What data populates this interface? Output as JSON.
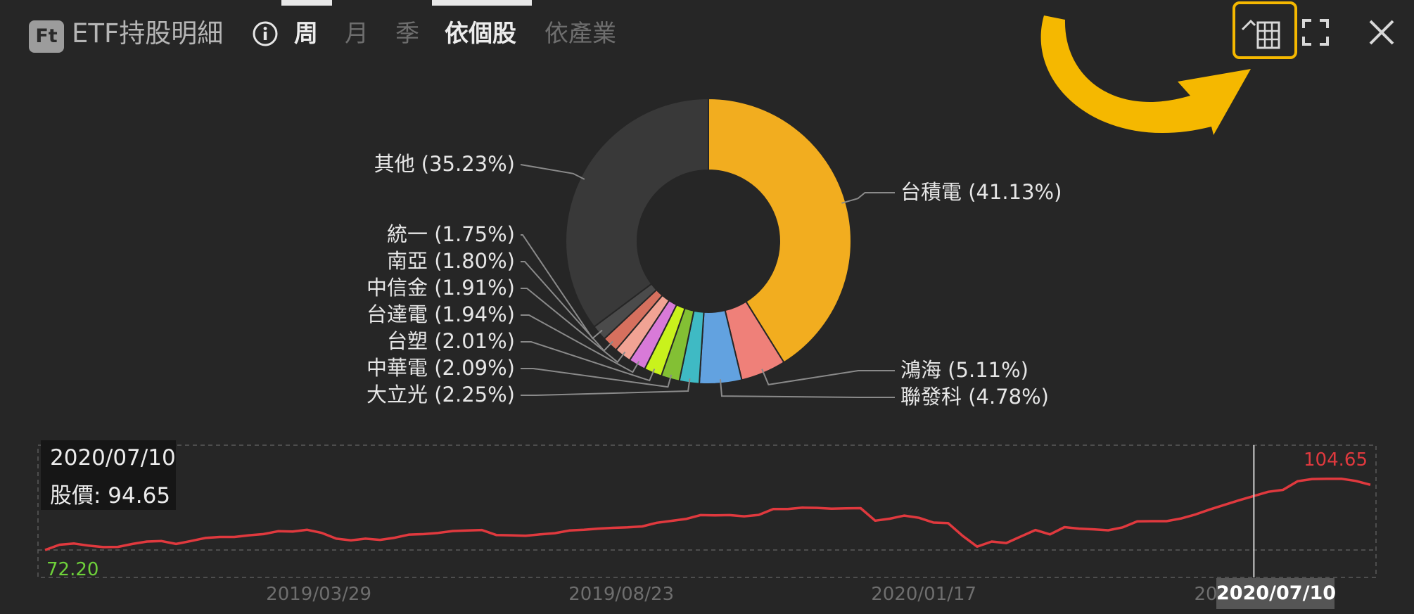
{
  "header": {
    "logo_text": "Ft",
    "title": "ETF持股明細",
    "info_icon": "info-icon",
    "period_tabs": [
      {
        "label": "周",
        "active": true
      },
      {
        "label": "月",
        "active": false
      },
      {
        "label": "季",
        "active": false
      }
    ],
    "view_tabs": [
      {
        "label": "依個股",
        "active": true
      },
      {
        "label": "依產業",
        "active": false
      }
    ],
    "tools": {
      "calculator_icon": "calculator-icon",
      "fullscreen_icon": "fullscreen-icon",
      "close_icon": "close-icon"
    }
  },
  "colors": {
    "background": "#262626",
    "highlight": "#f5b800",
    "price_line": "#e0393e",
    "min_label": "#6ed13a",
    "max_label": "#e0393e"
  },
  "chart_data": [
    {
      "type": "pie",
      "donut": true,
      "slices": [
        {
          "name": "台積電",
          "value": 41.13,
          "label": "台積電 (41.13%)",
          "color": "#f2ad1f"
        },
        {
          "name": "鴻海",
          "value": 5.11,
          "label": "鴻海 (5.11%)",
          "color": "#ef8079"
        },
        {
          "name": "聯發科",
          "value": 4.78,
          "label": "聯發科 (4.78%)",
          "color": "#62a2e0"
        },
        {
          "name": "大立光",
          "value": 2.25,
          "label": "大立光 (2.25%)",
          "color": "#3fbac4"
        },
        {
          "name": "中華電",
          "value": 2.09,
          "label": "中華電 (2.09%)",
          "color": "#83c034"
        },
        {
          "name": "台塑",
          "value": 2.01,
          "label": "台塑 (2.01%)",
          "color": "#c9f21c"
        },
        {
          "name": "台達電",
          "value": 1.94,
          "label": "台達電 (1.94%)",
          "color": "#d87ad8"
        },
        {
          "name": "中信金",
          "value": 1.91,
          "label": "中信金 (1.91%)",
          "color": "#f1a394"
        },
        {
          "name": "南亞",
          "value": 1.8,
          "label": "南亞 (1.80%)",
          "color": "#d6705e"
        },
        {
          "name": "統一",
          "value": 1.75,
          "label": "統一 (1.75%)",
          "color": "#4b4b4b"
        },
        {
          "name": "其他",
          "value": 35.23,
          "label": "其他 (35.23%)",
          "color": "#393939"
        }
      ]
    },
    {
      "type": "line",
      "x_ticks": [
        "2019/03/29",
        "2019/08/23",
        "2020/01/17",
        "2020/06/12"
      ],
      "x_tick_labels": [
        "2019/03/29",
        "2019/08/23",
        "2020/01/17",
        "2020/0"
      ],
      "x_start": "2018/11/16",
      "x_end": "2020/08/21",
      "ylim": [
        72.2,
        104.65
      ],
      "min_label": "72.20",
      "max_label": "104.65",
      "series": [
        {
          "values": [
            72.2,
            74.4,
            74.9,
            74.0,
            73.4,
            73.5,
            74.7,
            75.7,
            75.9,
            74.7,
            75.9,
            77.2,
            77.6,
            77.6,
            78.3,
            78.8,
            80.0,
            79.9,
            80.6,
            79.3,
            76.9,
            76.2,
            76.9,
            76.4,
            77.3,
            78.6,
            78.8,
            79.3,
            80.1,
            80.3,
            80.5,
            78.4,
            78.3,
            78.1,
            78.7,
            79.2,
            80.3,
            80.6,
            81.1,
            81.4,
            81.6,
            82.0,
            83.5,
            84.3,
            85.1,
            86.7,
            86.6,
            86.7,
            86.2,
            86.8,
            89.2,
            89.2,
            89.8,
            89.7,
            89.4,
            89.5,
            89.6,
            84.4,
            85.2,
            86.5,
            85.6,
            83.6,
            83.4,
            78.1,
            73.6,
            75.7,
            75.1,
            77.8,
            80.5,
            78.7,
            81.7,
            81.1,
            80.8,
            80.4,
            81.6,
            84.1,
            84.2,
            84.2,
            85.3,
            87.0,
            89.1,
            91.0,
            92.9,
            94.65,
            96.4,
            97.2,
            100.8,
            101.7,
            101.8,
            101.8,
            100.9,
            99.3
          ]
        }
      ]
    }
  ],
  "tooltip": {
    "date": "2020/07/10",
    "price_label": "股價:",
    "price_value": "94.65",
    "price_text": "股價:  94.65"
  },
  "cursor": {
    "date": "2020/07/10",
    "index": 83
  }
}
